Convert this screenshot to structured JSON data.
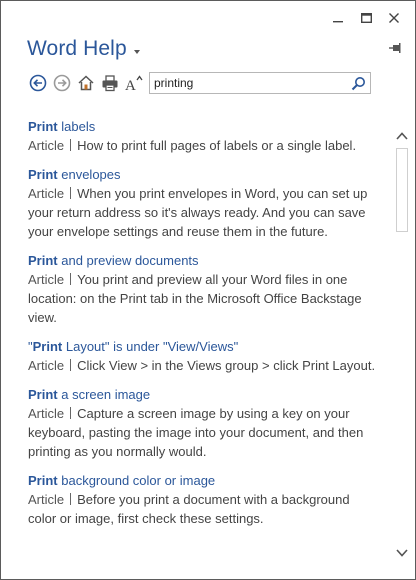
{
  "app": {
    "title": "Word Help"
  },
  "search": {
    "value": "printing",
    "placeholder": ""
  },
  "toolbar": {
    "icons": [
      "back-icon",
      "forward-icon",
      "home-icon",
      "print-icon",
      "font-size-icon",
      "search-icon"
    ]
  },
  "results": [
    {
      "bold": "Print",
      "rest": " labels",
      "type": "Article",
      "desc": "How to print full pages of labels or a single label."
    },
    {
      "bold": "Print",
      "rest": " envelopes",
      "type": "Article",
      "desc": "When you print envelopes in Word, you can set up your return address so it's always ready. And you can save your envelope settings and reuse them in the future."
    },
    {
      "bold": "Print",
      "rest": " and preview documents",
      "type": "Article",
      "desc": "You print and preview all your Word files in one location: on the Print tab in the Microsoft Office Backstage view."
    },
    {
      "pre": "\"",
      "bold": "Print",
      "rest": " Layout\" is under \"View/Views\"",
      "type": "Article",
      "desc": "Click View > in the Views group > click Print Layout."
    },
    {
      "bold": "Print",
      "rest": " a screen image",
      "type": "Article",
      "desc": "Capture a screen image by using a key on your keyboard, pasting the image into your document, and then printing as you normally would."
    },
    {
      "bold": "Print",
      "rest": " background color or image",
      "type": "Article",
      "desc": "Before you print a document with a background color or image, first check these settings."
    }
  ],
  "colors": {
    "accent": "#2b579a",
    "text": "#444444",
    "border": "#5b5b5b"
  }
}
